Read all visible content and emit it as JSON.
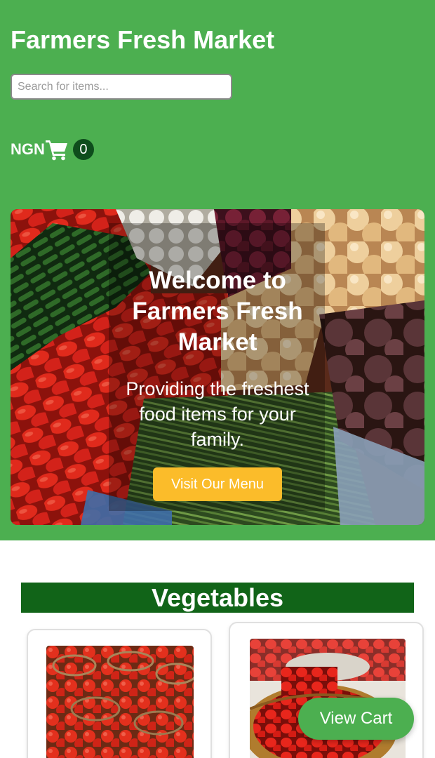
{
  "header": {
    "title": "Farmers Fresh Market",
    "search_placeholder": "Search for items...",
    "currency": "NGN",
    "cart_count": "0"
  },
  "hero": {
    "title": "Welcome to Farmers Fresh Market",
    "subtitle": "Providing the freshest food items for your family.",
    "button_label": "Visit Our Menu"
  },
  "sections": [
    {
      "heading": "Vegetables",
      "items": [
        {
          "image_alt": "tomatoes"
        },
        {
          "image_alt": "red peppers"
        }
      ]
    }
  ],
  "floating": {
    "view_cart_label": "View Cart"
  },
  "colors": {
    "brand_green": "#4caf50",
    "dark_green": "#116418",
    "badge_green": "#0e4d1c",
    "accent_yellow": "#fbbc2a"
  },
  "icons": {
    "cart": "shopping-cart-icon"
  }
}
